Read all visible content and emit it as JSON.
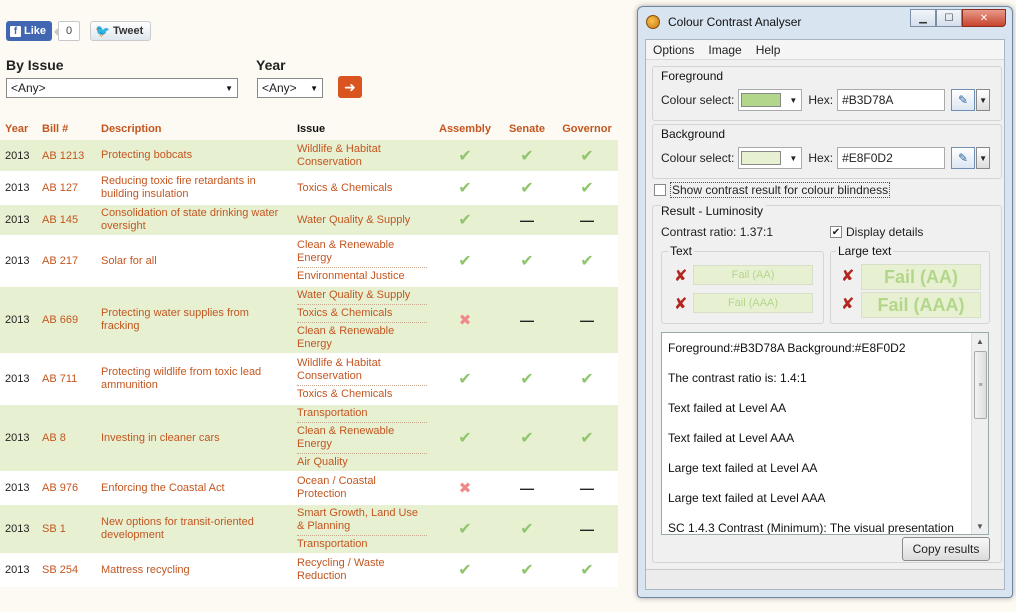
{
  "social": {
    "like_label": "Like",
    "like_count": "0",
    "tweet_label": "Tweet"
  },
  "filters": {
    "by_issue_label": "By Issue",
    "issue_value": "<Any>",
    "year_label": "Year",
    "year_value": "<Any>",
    "go_icon": "arrow-right-icon"
  },
  "table": {
    "headers": {
      "year": "Year",
      "bill": "Bill #",
      "description": "Description",
      "issue": "Issue",
      "assembly": "Assembly",
      "senate": "Senate",
      "governor": "Governor"
    },
    "rows": [
      {
        "year": "2013",
        "bill": "AB 1213",
        "description": "Protecting bobcats",
        "issues": [
          "Wildlife & Habitat Conservation"
        ],
        "assembly": "check",
        "senate": "check",
        "governor": "check"
      },
      {
        "year": "2013",
        "bill": "AB 127",
        "description": "Reducing toxic fire retardants in building insulation",
        "issues": [
          "Toxics & Chemicals"
        ],
        "assembly": "check",
        "senate": "check",
        "governor": "check"
      },
      {
        "year": "2013",
        "bill": "AB 145",
        "description": "Consolidation of state drinking water oversight",
        "issues": [
          "Water Quality & Supply"
        ],
        "assembly": "check",
        "senate": "dash",
        "governor": "dash"
      },
      {
        "year": "2013",
        "bill": "AB 217",
        "description": "Solar for all",
        "issues": [
          "Clean & Renewable Energy",
          "Environmental Justice"
        ],
        "assembly": "check",
        "senate": "check",
        "governor": "check"
      },
      {
        "year": "2013",
        "bill": "AB 669",
        "description": "Protecting water supplies from fracking",
        "issues": [
          "Water Quality & Supply",
          "Toxics & Chemicals",
          "Clean & Renewable Energy"
        ],
        "assembly": "cross",
        "senate": "dash",
        "governor": "dash"
      },
      {
        "year": "2013",
        "bill": "AB 711",
        "description": "Protecting wildlife from toxic lead ammunition",
        "issues": [
          "Wildlife & Habitat Conservation",
          "Toxics & Chemicals"
        ],
        "assembly": "check",
        "senate": "check",
        "governor": "check"
      },
      {
        "year": "2013",
        "bill": "AB 8",
        "description": "Investing in cleaner cars",
        "issues": [
          "Transportation",
          "Clean & Renewable Energy",
          "Air Quality"
        ],
        "assembly": "check",
        "senate": "check",
        "governor": "check"
      },
      {
        "year": "2013",
        "bill": "AB 976",
        "description": "Enforcing the Coastal Act",
        "issues": [
          "Ocean / Coastal Protection"
        ],
        "assembly": "cross",
        "senate": "dash",
        "governor": "dash"
      },
      {
        "year": "2013",
        "bill": "SB 1",
        "description": "New options for transit-oriented development",
        "issues": [
          "Smart Growth, Land Use & Planning",
          "Transportation"
        ],
        "assembly": "check",
        "senate": "check",
        "governor": "dash"
      },
      {
        "year": "2013",
        "bill": "SB 254",
        "description": "Mattress recycling",
        "issues": [
          "Recycling / Waste Reduction"
        ],
        "assembly": "check",
        "senate": "check",
        "governor": "check"
      }
    ]
  },
  "cca": {
    "title": "Colour Contrast Analyser",
    "menu": [
      "Options",
      "Image",
      "Help"
    ],
    "foreground": {
      "section": "Foreground",
      "colour_select_label": "Colour select:",
      "hex_label": "Hex:",
      "hex": "#B3D78A",
      "color": "#B3D78A"
    },
    "background": {
      "section": "Background",
      "colour_select_label": "Colour select:",
      "hex_label": "Hex:",
      "hex": "#E8F0D2",
      "color": "#E8F0D2"
    },
    "blindness_label": "Show contrast result for colour blindness",
    "blindness_checked": false,
    "result_label": "Result - Luminosity",
    "contrast_ratio": "Contrast ratio: 1.37:1",
    "display_details_label": "Display details",
    "display_details_checked": true,
    "text_group_label": "Text",
    "large_text_group_label": "Large text",
    "fail_aa": "Fail (AA)",
    "fail_aaa": "Fail (AAA)",
    "details_lines": [
      "Foreground:#B3D78A Background:#E8F0D2",
      "The contrast ratio is: 1.4:1",
      "Text failed at Level AA",
      "Text failed at Level AAA",
      "Large text failed at Level AA",
      "Large text failed at Level AAA",
      "SC 1.4.3 Contrast (Minimum): The visual presentation"
    ],
    "copy_button": "Copy results"
  }
}
